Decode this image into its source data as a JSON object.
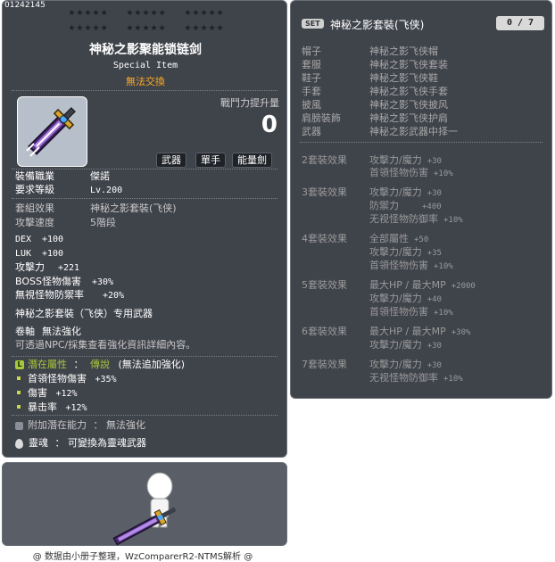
{
  "item_id": "01242145",
  "star_groups": [
    "★★★★★",
    "★★★★★",
    "★★★★★",
    "★★★★★",
    "★★★★★",
    "★★★★★"
  ],
  "item": {
    "name": "神秘之影聚能锁链剑",
    "subtitle": "Special Item",
    "trade": "無法交換",
    "power_label": "戰鬥力提升量",
    "power_value": "0",
    "tags": [
      "武器",
      "單手",
      "能量劍"
    ],
    "job_label": "裝備職業",
    "job_value": "傑諾",
    "level_label": "要求等級",
    "level_value": "Lv.200",
    "set_label": "套組效果",
    "set_value": "神秘之影套裝(飞侠)",
    "speed_label": "攻擊速度",
    "speed_value": "5階段",
    "stats": [
      {
        "label": "DEX",
        "value": "+100"
      },
      {
        "label": "LUK",
        "value": "+100"
      },
      {
        "label": "攻擊力",
        "value": "+221"
      },
      {
        "label": "BOSS怪物傷害",
        "value": "+30%"
      },
      {
        "label": "無視怪物防禦率",
        "value": "+20%"
      }
    ],
    "special_weapon": "神秘之影套裝（飞侠）专用武器",
    "scroll_label": "卷軸",
    "scroll_value": "無法強化",
    "scroll_hint": "可透過NPC/採集查看強化資訊詳細內容。",
    "potential_label": "潛在屬性",
    "potential_sep": "：",
    "potential_rank": "傳說",
    "potential_note": "(無法追加強化)",
    "potential_lines": [
      {
        "label": "首領怪物傷害",
        "value": "+35%"
      },
      {
        "label": "傷害",
        "value": "+12%"
      },
      {
        "label": "暴击率",
        "value": "+12%"
      }
    ],
    "addpot_label": "附加潛在能力",
    "addpot_value": "：  無法強化",
    "soul_label": "靈魂",
    "soul_value": "：  可變換為靈魂武器"
  },
  "set": {
    "badge": "SET",
    "name": "神秘之影套裝(飞侠)",
    "count": "0 / 7",
    "parts": [
      {
        "slot": "帽子",
        "name": "神秘之影飞侠帽"
      },
      {
        "slot": "套服",
        "name": "神秘之影飞侠套装"
      },
      {
        "slot": "鞋子",
        "name": "神秘之影飞侠鞋"
      },
      {
        "slot": "手套",
        "name": "神秘之影飞侠手套"
      },
      {
        "slot": "披風",
        "name": "神秘之影飞侠披风"
      },
      {
        "slot": "肩膀裝飾",
        "name": "神秘之影飞侠护肩"
      },
      {
        "slot": "武器",
        "name": "神秘之影武器中择一"
      }
    ],
    "effects": [
      {
        "label": "2套裝效果",
        "lines": [
          {
            "t": "攻擊力/魔力",
            "v": "+30"
          },
          {
            "t": "首領怪物伤害",
            "v": "+10%"
          }
        ]
      },
      {
        "label": "3套裝效果",
        "lines": [
          {
            "t": "攻擊力/魔力",
            "v": "+30"
          },
          {
            "t": "防禦力",
            "v": "+400"
          },
          {
            "t": "无视怪物防御率",
            "v": "+10%"
          }
        ]
      },
      {
        "label": "4套裝效果",
        "lines": [
          {
            "t": "全部屬性",
            "v": "+50"
          },
          {
            "t": "攻擊力/魔力",
            "v": "+35"
          },
          {
            "t": "首領怪物伤害",
            "v": "+10%"
          }
        ]
      },
      {
        "label": "5套裝效果",
        "lines": [
          {
            "t": "最大HP / 最大MP",
            "v": "+2000"
          },
          {
            "t": "攻擊力/魔力",
            "v": "+40"
          },
          {
            "t": "首領怪物伤害",
            "v": "+10%"
          }
        ]
      },
      {
        "label": "6套裝效果",
        "lines": [
          {
            "t": "最大HP / 最大MP",
            "v": "+30%"
          },
          {
            "t": "攻擊力/魔力",
            "v": "+30"
          }
        ]
      },
      {
        "label": "7套裝效果",
        "lines": [
          {
            "t": "攻擊力/魔力",
            "v": "+30"
          },
          {
            "t": "无视怪物防御率",
            "v": "+10%"
          }
        ]
      }
    ]
  },
  "footer": "@ 数据由小册子整理，WzComparerR2-NTMS解析 @",
  "colors": {
    "panel_bg": "#3f434a",
    "trade_orange": "#ffaa22",
    "potential_green": "#a6c83a",
    "set_gray": "#a8a8a8"
  }
}
